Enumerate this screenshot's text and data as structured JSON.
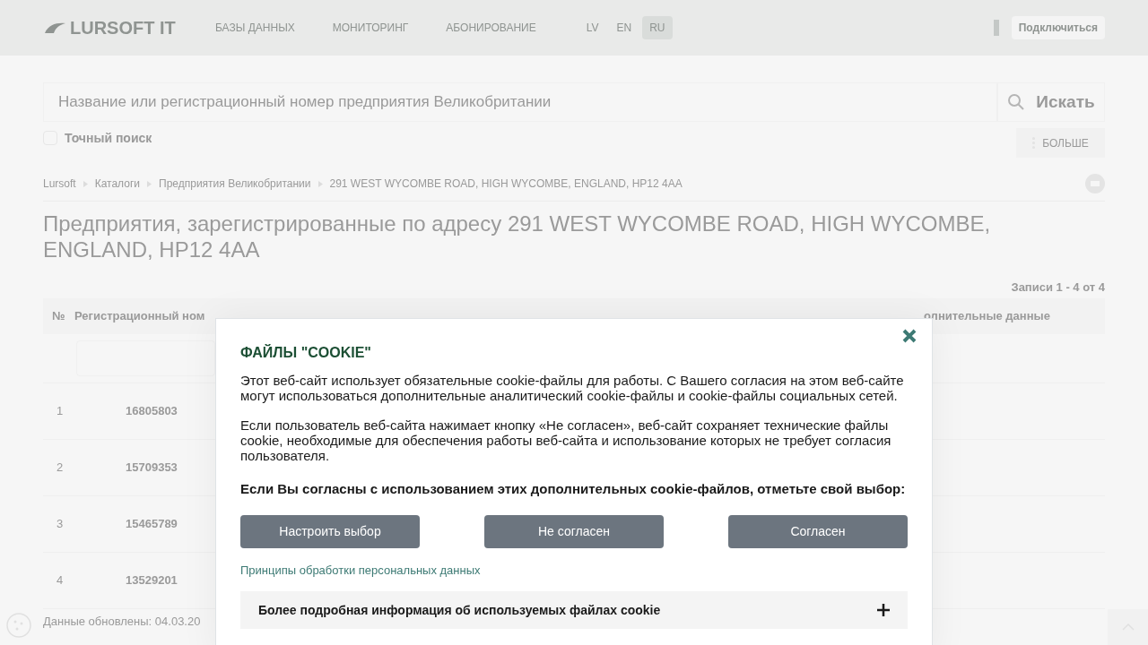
{
  "header": {
    "logo": "LURSOFT IT",
    "nav": [
      {
        "label": "БАЗЫ ДАННЫХ"
      },
      {
        "label": "МОНИТОРИНГ"
      },
      {
        "label": "АБОНИРОВАНИЕ"
      }
    ],
    "languages": [
      {
        "label": "LV",
        "selected": false
      },
      {
        "label": "EN",
        "selected": false
      },
      {
        "label": "RU",
        "selected": true
      }
    ],
    "connect_button": "Подключиться"
  },
  "search": {
    "placeholder": "Название или регистрационный номер предприятия Великобритании",
    "button": "Искать",
    "exact_label": "Точный поиск",
    "exact_checked": false,
    "more_button": "БОЛЬШЕ"
  },
  "breadcrumbs": [
    "Lursoft",
    "Каталоги",
    "Предприятия Великобритании",
    "291 WEST WYCOMBE ROAD, HIGH WYCOMBE, ENGLAND, HP12 4AA"
  ],
  "title": "Предприятия, зарегистрированные по адресу 291 WEST WYCOMBE ROAD, HIGH WYCOMBE, ENGLAND, HP12 4AA",
  "records": "Записи 1 - 4 от 4",
  "table": {
    "columns": [
      "№",
      "Регистрационный ном",
      "олнительные данные"
    ],
    "rows": [
      [
        "1",
        "16805803"
      ],
      [
        "2",
        "15709353"
      ],
      [
        "3",
        "15465789"
      ],
      [
        "4",
        "13529201"
      ]
    ]
  },
  "footer_note": "Данные обновлены: 04.03.20",
  "cookie_dialog": {
    "title": "ФАЙЛЫ \"COOKIE\"",
    "paragraphs": [
      "Этот веб-сайт использует обязательные cookie-файлы для работы. С Вашего согласия на этом веб-сайте могут использоваться дополнительные аналитический cookie-файлы и cookie-файлы социальных сетей.",
      "Если пользователь веб-сайта нажимает кнопку «Не согласен», веб-сайт сохраняет технические файлы cookie, необходимые для обеспечения работы веб-сайта и использование которых не требует согласия пользователя."
    ],
    "prompt": "Если Вы согласны с использованием этих дополнительных cookie-файлов, отметьте свой выбор:",
    "buttons": [
      "Настроить выбор",
      "Не согласен",
      "Согласен"
    ],
    "link": "Принципы обработки персональных данных",
    "accordion": {
      "label": "Более подробная информация об используемых файлах cookie",
      "expanded": false
    }
  }
}
